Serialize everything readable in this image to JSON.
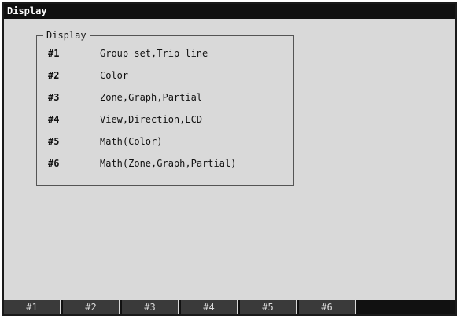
{
  "window": {
    "title": "Display"
  },
  "group": {
    "legend": "Display",
    "items": [
      {
        "num": "#1",
        "label": "Group set,Trip line"
      },
      {
        "num": "#2",
        "label": "Color"
      },
      {
        "num": "#3",
        "label": "Zone,Graph,Partial"
      },
      {
        "num": "#4",
        "label": "View,Direction,LCD"
      },
      {
        "num": "#5",
        "label": "Math(Color)"
      },
      {
        "num": "#6",
        "label": "Math(Zone,Graph,Partial)"
      }
    ]
  },
  "softkeys": [
    "#1",
    "#2",
    "#3",
    "#4",
    "#5",
    "#6"
  ]
}
